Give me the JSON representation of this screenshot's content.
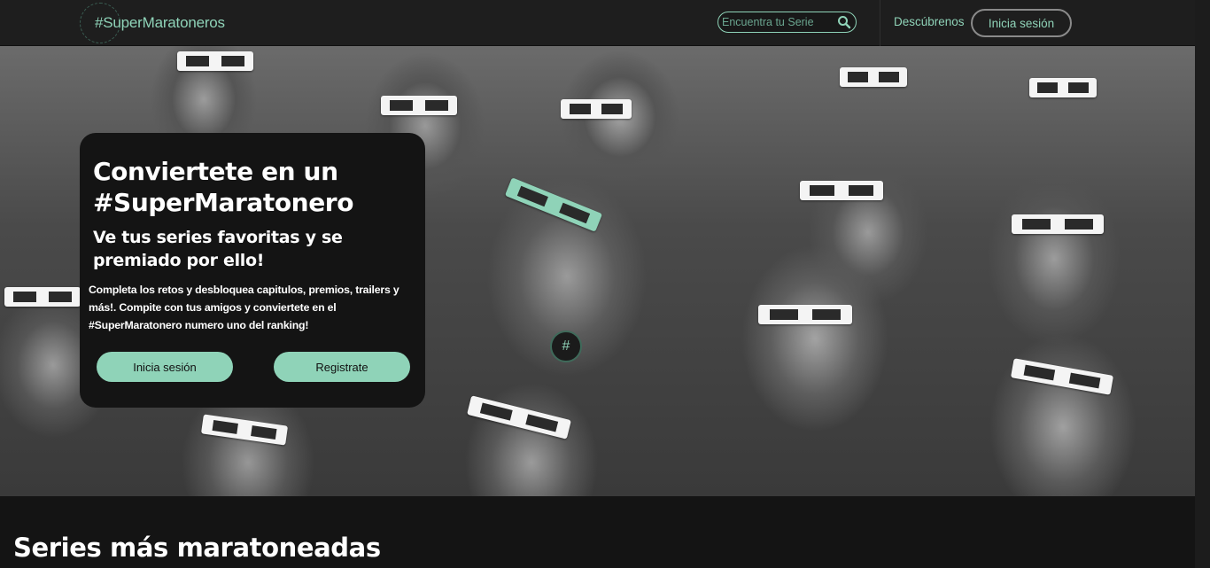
{
  "navbar": {
    "logo_text": "#SuperMaratoneros",
    "search_placeholder": "Encuentra tu Serie",
    "discover_link": "Descúbrenos",
    "login_button": "Inicia sesión"
  },
  "hero": {
    "title": "Conviertete en un #SuperMaratonero",
    "subtitle": "Ve tus series favoritas y se premiado por ello!",
    "description": "Completa los retos y desbloquea capitulos, premios, trailers y más!. Compite con tus amigos y conviertete en el #SuperMaratonero numero uno del ranking!",
    "login_button": "Inicia sesión",
    "register_button": "Registrate",
    "badge_symbol": "#"
  },
  "sections": {
    "most_watched_title": "Series más maratoneadas"
  },
  "colors": {
    "accent": "#8fd3b8",
    "background": "#141414",
    "navbar": "#1e1e1e"
  },
  "icons": {
    "search": "search-icon",
    "logo": "logo-ring-icon"
  }
}
